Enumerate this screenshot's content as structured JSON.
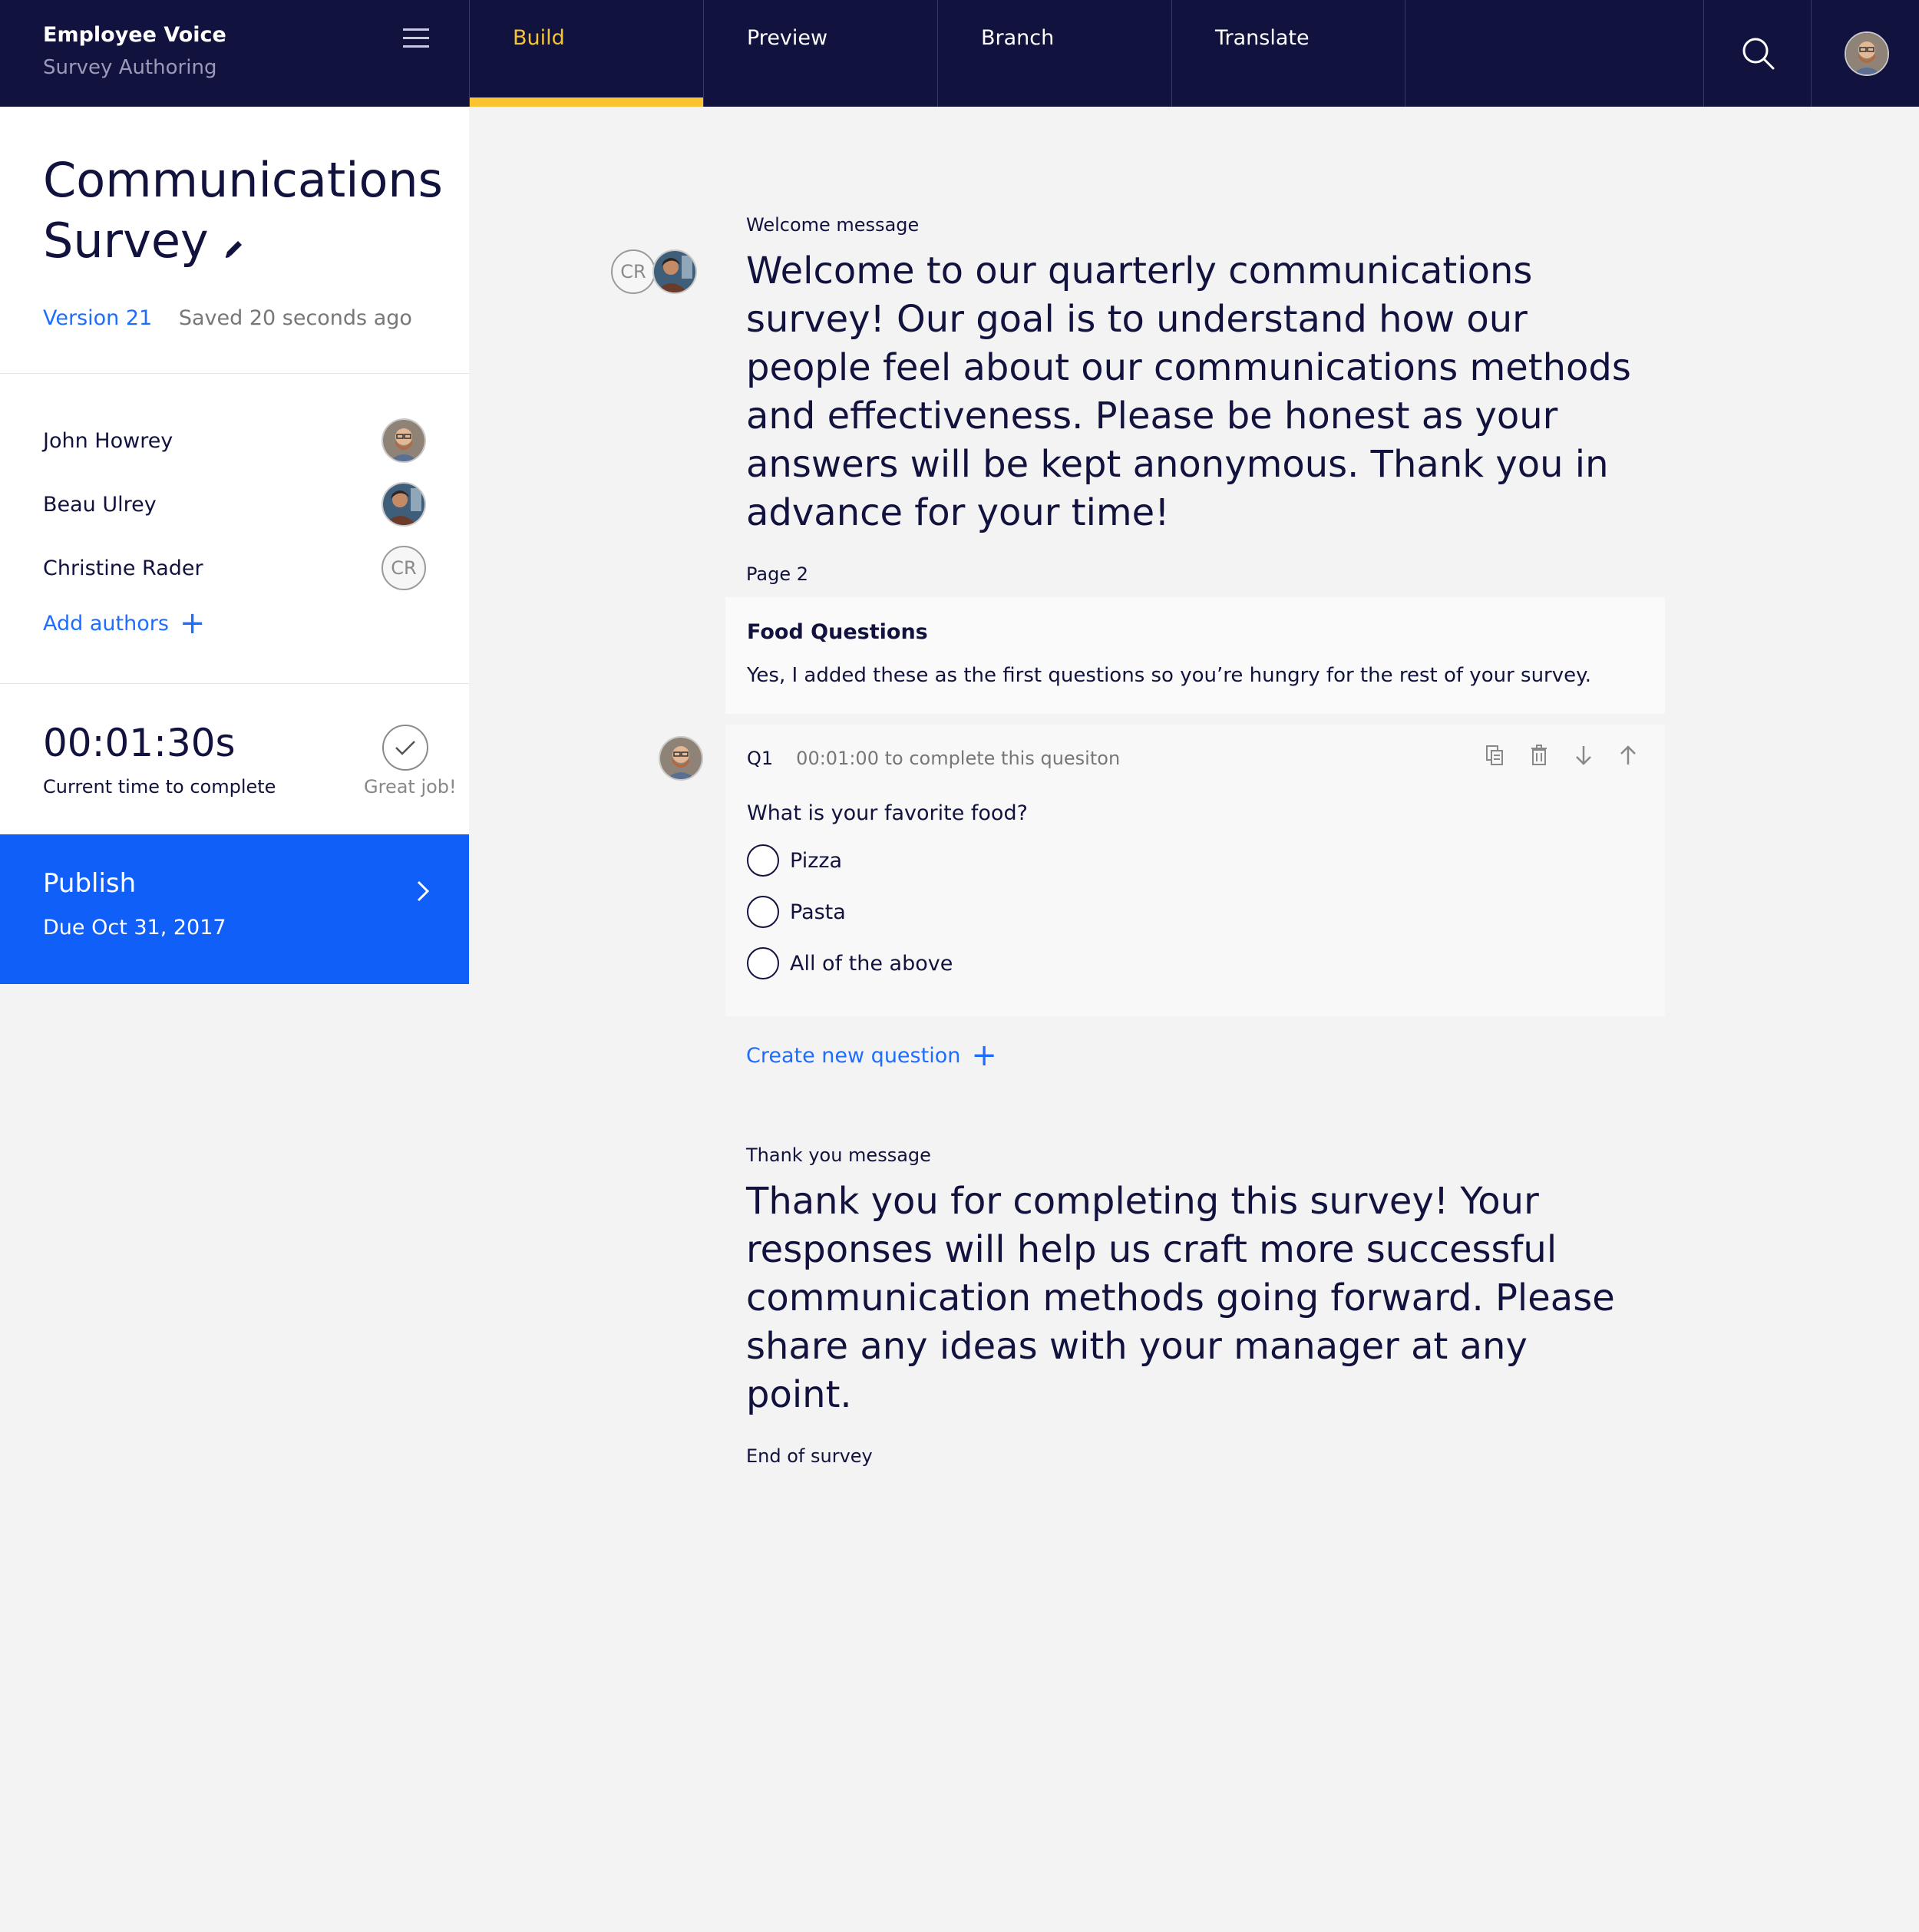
{
  "topbar": {
    "app_title": "Employee Voice",
    "app_subtitle": "Survey Authoring",
    "tabs": [
      {
        "label": "Build",
        "active": true
      },
      {
        "label": "Preview",
        "active": false
      },
      {
        "label": "Branch",
        "active": false
      },
      {
        "label": "Translate",
        "active": false
      }
    ],
    "icons": [
      "menu-icon",
      "search-icon",
      "user-avatar"
    ]
  },
  "sidebar": {
    "survey_title": "Communications Survey",
    "version": "Version 21",
    "saved_status": "Saved 20 seconds ago",
    "authors": [
      {
        "name": "John Howrey",
        "avatar": "photo"
      },
      {
        "name": "Beau Ulrey",
        "avatar": "photo"
      },
      {
        "name": "Christine Rader",
        "avatar": "CR"
      }
    ],
    "add_authors_label": "Add authors",
    "time_to_complete": "00:01:30s",
    "time_label": "Current time to complete",
    "status_message": "Great job!",
    "publish_label": "Publish",
    "publish_due": "Due Oct 31, 2017"
  },
  "main": {
    "welcome_label": "Welcome message",
    "welcome_avatar_initials": "CR",
    "welcome_text": "Welcome to our quarterly communications survey! Our goal is to understand how our people feel about our communications methods and effectiveness. Please be honest as your answers will be kept anonymous. Thank you in advance for your time!",
    "page_label": "Page 2",
    "page_title": "Food Questions",
    "page_description": "Yes, I added these as the first questions so you’re hungry for the rest of your survey.",
    "question": {
      "number": "Q1",
      "time": "00:01:00 to complete this quesiton",
      "text": "What is your favorite food?",
      "options": [
        "Pizza",
        "Pasta",
        "All of the above"
      ]
    },
    "create_question_label": "Create new question",
    "thank_you_label": "Thank you message",
    "thank_you_text": "Thank you for completing this survey! Your responses will help us craft more successful communication methods going forward. Please share any ideas with your manager at any point.",
    "end_label": "End of survey"
  },
  "colors": {
    "topbar_bg": "#12123f",
    "active_tab": "#f9c430",
    "accent_blue": "#1f6dff",
    "publish_bg": "#0f5ff8",
    "canvas_bg": "#f3f3f3"
  }
}
